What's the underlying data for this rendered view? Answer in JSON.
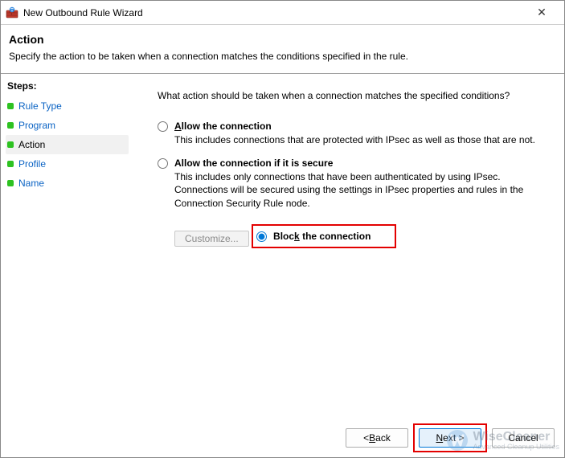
{
  "window": {
    "title": "New Outbound Rule Wizard",
    "close_label": "✕"
  },
  "header": {
    "title": "Action",
    "subtitle": "Specify the action to be taken when a connection matches the conditions specified in the rule."
  },
  "steps": {
    "title": "Steps:",
    "items": [
      {
        "label": "Rule Type",
        "active": false
      },
      {
        "label": "Program",
        "active": false
      },
      {
        "label": "Action",
        "active": true
      },
      {
        "label": "Profile",
        "active": false
      },
      {
        "label": "Name",
        "active": false
      }
    ]
  },
  "content": {
    "question": "What action should be taken when a connection matches the specified conditions?",
    "options": {
      "allow": {
        "title_pre": "A",
        "title_post": "llow the connection",
        "desc": "This includes connections that are protected with IPsec as well as those that are not.",
        "selected": false
      },
      "allow_secure": {
        "title": "Allow the connection if it is secure",
        "desc": "This includes only connections that have been authenticated by using IPsec.  Connections will be secured using the settings in IPsec properties and rules in the Connection Security Rule node.",
        "selected": false
      },
      "block": {
        "title_pre": "Bloc",
        "title_mn": "k",
        "title_post": " the connection",
        "selected": true
      }
    },
    "customize_label": "Customize..."
  },
  "footer": {
    "back_pre": "< ",
    "back_mn": "B",
    "back_post": "ack",
    "next_mn": "N",
    "next_post": "ext >",
    "cancel": "Cancel"
  },
  "watermark": {
    "main": "WiseCleaner",
    "sub": "Advanced Cleanup Utilities"
  }
}
